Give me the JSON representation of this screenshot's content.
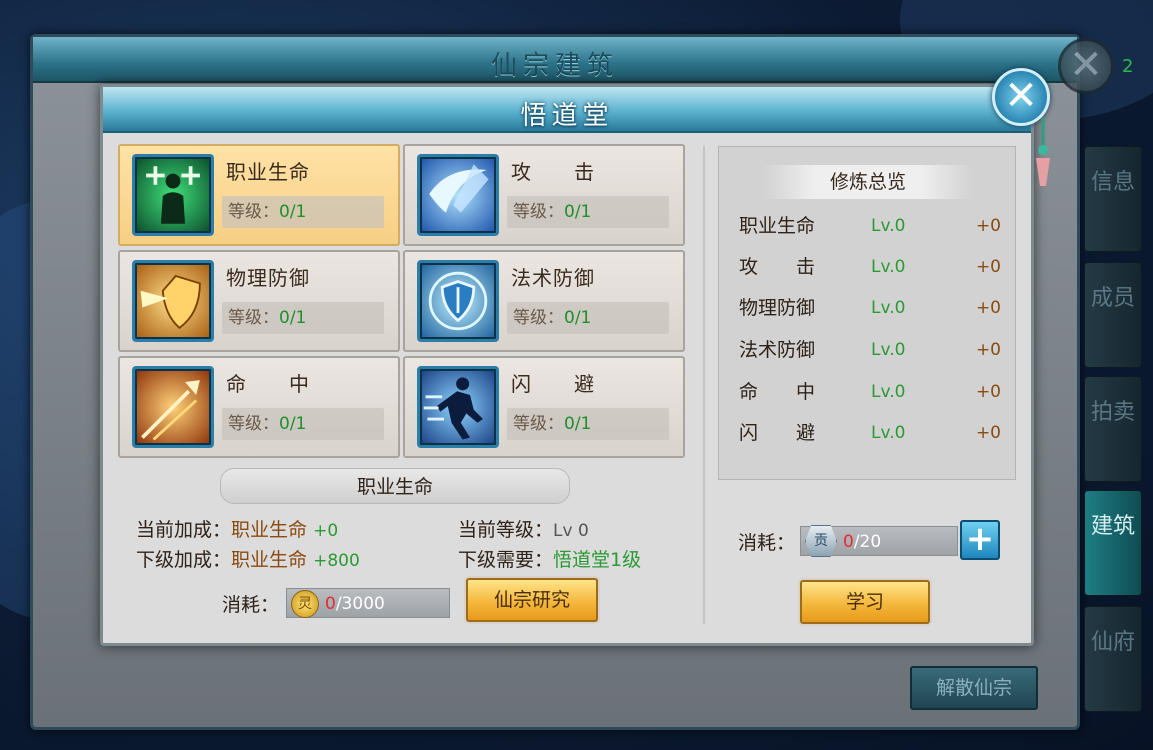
{
  "outer_window": {
    "title": "仙宗建筑",
    "count": "2"
  },
  "sidebar_tabs": [
    {
      "label": "信息",
      "active": false
    },
    {
      "label": "成员",
      "active": false
    },
    {
      "label": "拍卖",
      "active": false
    },
    {
      "label": "建筑",
      "active": true
    },
    {
      "label": "仙府",
      "active": false
    }
  ],
  "disband_label": "解散仙宗",
  "dialog": {
    "title": "悟道堂"
  },
  "level_prefix": "等级：",
  "skills": [
    {
      "name": "职业生命",
      "level": "0/1",
      "icon": "life-icon",
      "selected": true
    },
    {
      "name": "攻　　击",
      "level": "0/1",
      "icon": "attack-icon",
      "selected": false
    },
    {
      "name": "物理防御",
      "level": "0/1",
      "icon": "physical-defense-icon",
      "selected": false
    },
    {
      "name": "法术防御",
      "level": "0/1",
      "icon": "magic-defense-icon",
      "selected": false
    },
    {
      "name": "命　　中",
      "level": "0/1",
      "icon": "hit-icon",
      "selected": false
    },
    {
      "name": "闪　　避",
      "level": "0/1",
      "icon": "dodge-icon",
      "selected": false
    }
  ],
  "overview": {
    "title": "修炼总览",
    "rows": [
      {
        "name": "职业生命",
        "lv": "Lv.0",
        "bonus": "+0"
      },
      {
        "name": "攻　　击",
        "lv": "Lv.0",
        "bonus": "+0"
      },
      {
        "name": "物理防御",
        "lv": "Lv.0",
        "bonus": "+0"
      },
      {
        "name": "法术防御",
        "lv": "Lv.0",
        "bonus": "+0"
      },
      {
        "name": "命　　中",
        "lv": "Lv.0",
        "bonus": "+0"
      },
      {
        "name": "闪　　避",
        "lv": "Lv.0",
        "bonus": "+0"
      }
    ]
  },
  "selected_skill": "职业生命",
  "details": {
    "current_bonus_label": "当前加成：",
    "current_bonus_name": "职业生命",
    "current_bonus_value": "+0",
    "next_bonus_label": "下级加成：",
    "next_bonus_name": "职业生命",
    "next_bonus_value": "+800",
    "current_level_label": "当前等级：",
    "current_level_value": "Lv 0",
    "next_require_label": "下级需要：",
    "next_require_value": "悟道堂1级"
  },
  "research_cost": {
    "label": "消耗：",
    "have": "0",
    "need": "/3000",
    "icon": "coin-icon",
    "icon_glyph": "灵"
  },
  "research_button": "仙宗研究",
  "learn_cost": {
    "label": "消耗：",
    "have": "0",
    "need": "/20",
    "icon": "contribution-token-icon",
    "icon_glyph": "贡"
  },
  "learn_button": "学习",
  "plus_label": "+",
  "close_glyph": "✕"
}
